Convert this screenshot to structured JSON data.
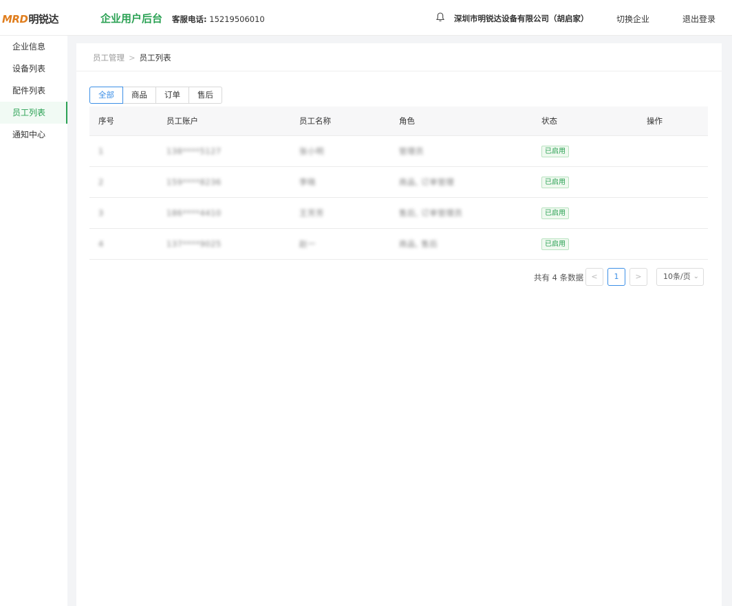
{
  "header": {
    "logo_latin": "MRD",
    "logo_cn": "明锐达",
    "portal_title": "企业用户后台",
    "hotline_label": "客服电话:",
    "hotline_number": "15219506010",
    "bell_icon": "bell-icon",
    "company": "深圳市明锐达设备有限公司（胡启家）",
    "switch_label": "切换企业",
    "logout_label": "退出登录"
  },
  "sidebar": {
    "items": [
      {
        "label": "企业信息"
      },
      {
        "label": "设备列表"
      },
      {
        "label": "配件列表"
      },
      {
        "label": "员工列表",
        "active": true
      },
      {
        "label": "通知中心"
      }
    ]
  },
  "breadcrumb": {
    "parent": "员工管理",
    "separator": ">",
    "current": "员工列表"
  },
  "tabs": [
    {
      "label": "全部",
      "active": true
    },
    {
      "label": "商品"
    },
    {
      "label": "订单"
    },
    {
      "label": "售后"
    }
  ],
  "table": {
    "headers": [
      "序号",
      "员工账户",
      "员工名称",
      "角色",
      "状态",
      "操作"
    ],
    "rows": [
      {
        "idx": "1",
        "account": "138****5127",
        "name": "张小明",
        "role": "管理员",
        "status": "已启用",
        "action": ""
      },
      {
        "idx": "2",
        "account": "159****8236",
        "name": "李晓",
        "role": "商品, 订单管理",
        "status": "已启用",
        "action": ""
      },
      {
        "idx": "3",
        "account": "186****4410",
        "name": "王芳芳",
        "role": "售后, 订单管理员",
        "status": "已启用",
        "action": ""
      },
      {
        "idx": "4",
        "account": "137****9025",
        "name": "赵一",
        "role": "商品, 售后",
        "status": "已启用",
        "action": ""
      }
    ]
  },
  "pagination": {
    "total_text": "共有 4 条数据",
    "prev_label": "<",
    "current_page": "1",
    "next_label": ">",
    "page_size": "10条/页",
    "chevron_icon": "chevron-down-icon"
  },
  "colors": {
    "brand_green": "#2aa153",
    "accent_blue": "#3a8ee6",
    "logo_orange": "#e07e1e"
  }
}
